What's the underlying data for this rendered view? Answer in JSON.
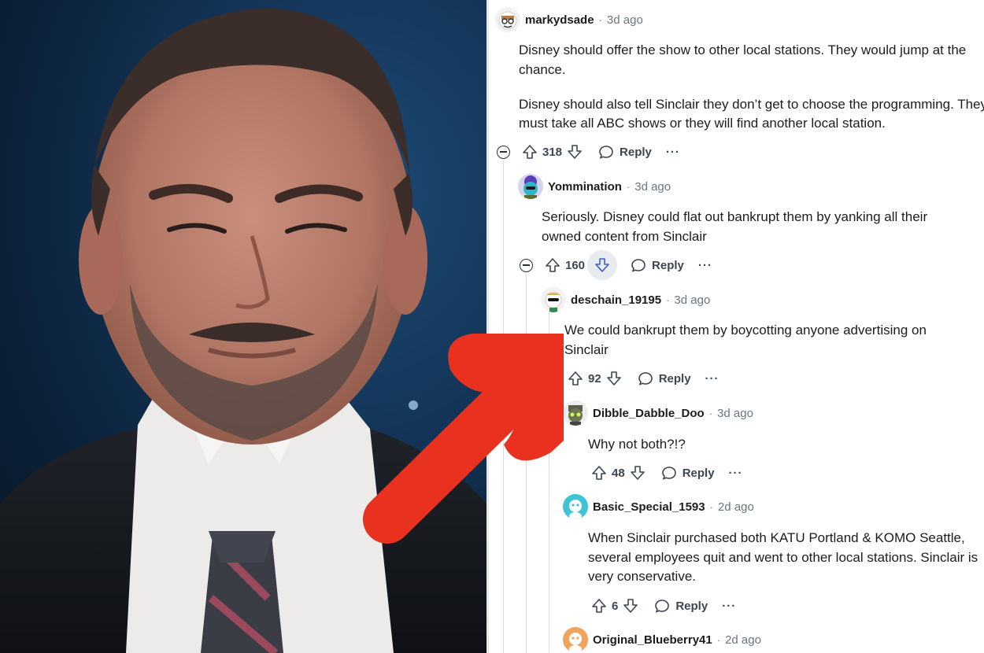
{
  "thread": {
    "icons": {
      "upvote": "upvote-arrow-icon",
      "downvote": "downvote-arrow-icon",
      "reply": "chat-bubble-icon",
      "more": "ellipsis-icon",
      "collapse": "collapse-minus-icon"
    },
    "labels": {
      "reply": "Reply",
      "more": "···",
      "separator": "·"
    },
    "comments": [
      {
        "user": "markydsade",
        "time": "3d ago",
        "score": "318",
        "body": [
          "Disney should offer the show to other local stations. They would jump at the chance.",
          "Disney should also tell Sinclair they don’t get to choose the programming. They must take all ABC shows or they will find another local station."
        ]
      },
      {
        "user": "Yommination",
        "time": "3d ago",
        "score": "160",
        "body": [
          "Seriously. Disney could flat out bankrupt them by yanking all their owned content from Sinclair"
        ],
        "downvote_highlighted": true
      },
      {
        "user": "deschain_19195",
        "time": "3d ago",
        "score": "92",
        "body": [
          "We could bankrupt them by boycotting anyone advertising on Sinclair"
        ]
      },
      {
        "user": "Dibble_Dabble_Doo",
        "time": "3d ago",
        "score": "48",
        "body": [
          "Why not both?!?"
        ]
      },
      {
        "user": "Basic_Special_1593",
        "time": "2d ago",
        "score": "6",
        "body": [
          "When Sinclair purchased both KATU Portland & KOMO Seattle, several employees quit and went to other local stations. Sinclair is very conservative."
        ]
      },
      {
        "user": "Original_Blueberry41",
        "time": "2d ago"
      }
    ]
  },
  "colors": {
    "annotation_arrow": "#e8321f",
    "photo_background": "#14365a",
    "meta_text": "#6b7580"
  }
}
